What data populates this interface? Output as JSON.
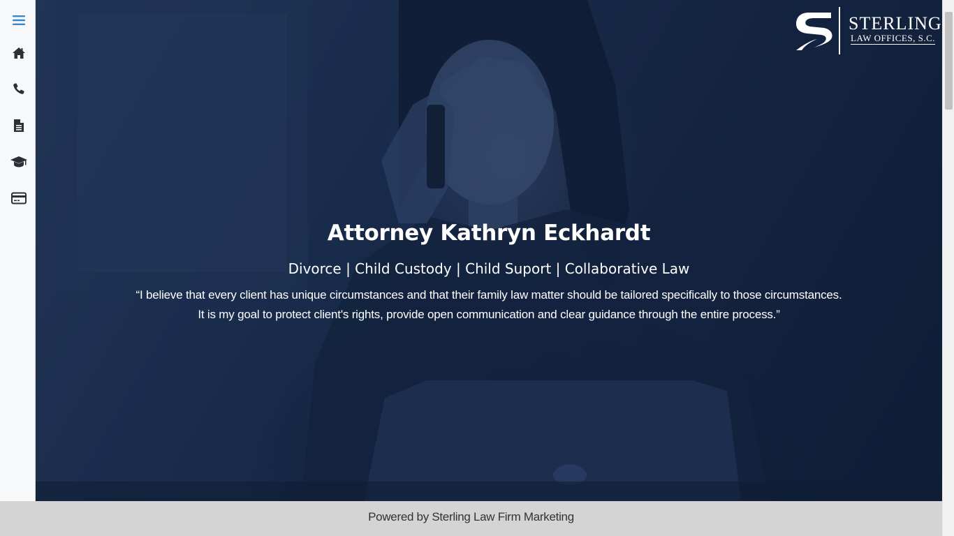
{
  "sidebar": {
    "items": [
      {
        "name": "menu",
        "icon": "hamburger-menu-icon"
      },
      {
        "name": "home",
        "icon": "home-icon"
      },
      {
        "name": "phone",
        "icon": "phone-icon"
      },
      {
        "name": "document",
        "icon": "document-icon"
      },
      {
        "name": "education",
        "icon": "graduation-cap-icon"
      },
      {
        "name": "payment",
        "icon": "credit-card-icon"
      }
    ],
    "menu_icon_color": "#3a87c8",
    "icon_color": "#2b2f36"
  },
  "logo": {
    "name": "Sterling",
    "subtitle": "Law Offices, S.C."
  },
  "hero": {
    "title": "Attorney Kathryn Eckhardt",
    "practice_areas": "Divorce | Child Custody | Child Suport | Collaborative Law",
    "quote_line_1": "“I believe that every client has unique circumstances and that their family law matter should be tailored specifically to those circumstances.",
    "quote_line_2": "It is my goal to protect client's rights, provide open communication and clear guidance through the entire process.”",
    "overlay_color": "#1b2f52"
  },
  "footer": {
    "text": "Powered by Sterling Law Firm Marketing"
  }
}
